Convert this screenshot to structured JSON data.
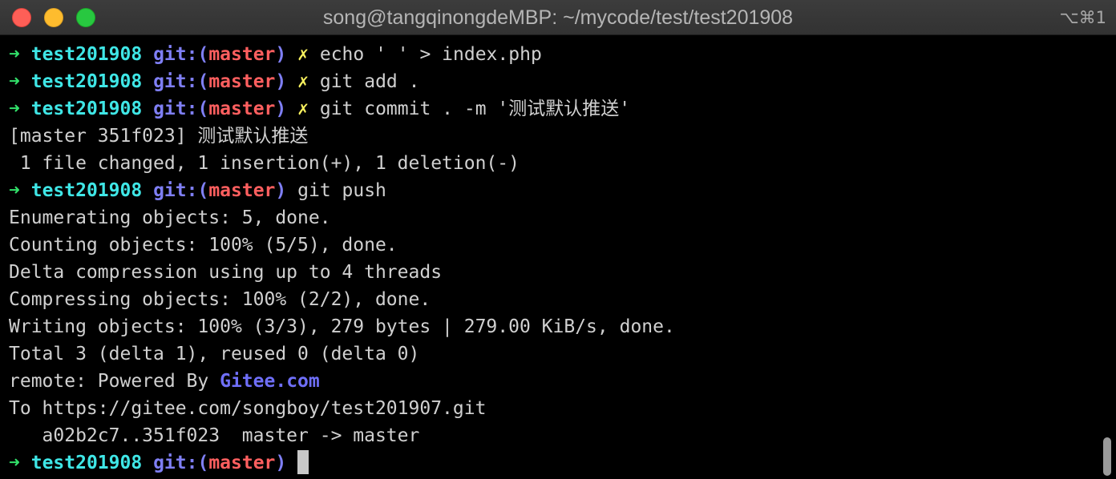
{
  "window": {
    "title": "song@tangqinongdeMBP: ~/mycode/test/test201908",
    "shortcut": "⌥⌘1"
  },
  "prompt": {
    "arrow": "➜",
    "dir": "test201908",
    "git_prefix": "git:(",
    "branch": "master",
    "git_suffix": ")",
    "dirty_mark": "✗"
  },
  "lines": [
    {
      "type": "prompt",
      "dirty": true,
      "cmd": "echo ' ' > index.php"
    },
    {
      "type": "prompt",
      "dirty": true,
      "cmd": "git add ."
    },
    {
      "type": "prompt",
      "dirty": true,
      "cmd": "git commit . -m '测试默认推送'"
    },
    {
      "type": "output",
      "text": "[master 351f023] 测试默认推送"
    },
    {
      "type": "output",
      "text": " 1 file changed, 1 insertion(+), 1 deletion(-)"
    },
    {
      "type": "prompt",
      "dirty": false,
      "cmd": "git push"
    },
    {
      "type": "output",
      "text": "Enumerating objects: 5, done."
    },
    {
      "type": "output",
      "text": "Counting objects: 100% (5/5), done."
    },
    {
      "type": "output",
      "text": "Delta compression using up to 4 threads"
    },
    {
      "type": "output",
      "text": "Compressing objects: 100% (2/2), done."
    },
    {
      "type": "output",
      "text": "Writing objects: 100% (3/3), 279 bytes | 279.00 KiB/s, done."
    },
    {
      "type": "output",
      "text": "Total 3 (delta 1), reused 0 (delta 0)"
    },
    {
      "type": "remote",
      "text": "remote: Powered By ",
      "link": "Gitee.com"
    },
    {
      "type": "output",
      "text": "To https://gitee.com/songboy/test201907.git"
    },
    {
      "type": "output",
      "text": "   a02b2c7..351f023  master -> master"
    },
    {
      "type": "prompt",
      "dirty": false,
      "cmd": "",
      "cursor": true
    }
  ],
  "colors": {
    "arrow": "#32e06a",
    "dir": "#3fe6e6",
    "git": "#7f7ff5",
    "branch": "#ff5f5f",
    "dirty": "#f8f15e",
    "text": "#d0d0d0",
    "link": "#6f6ff9"
  }
}
